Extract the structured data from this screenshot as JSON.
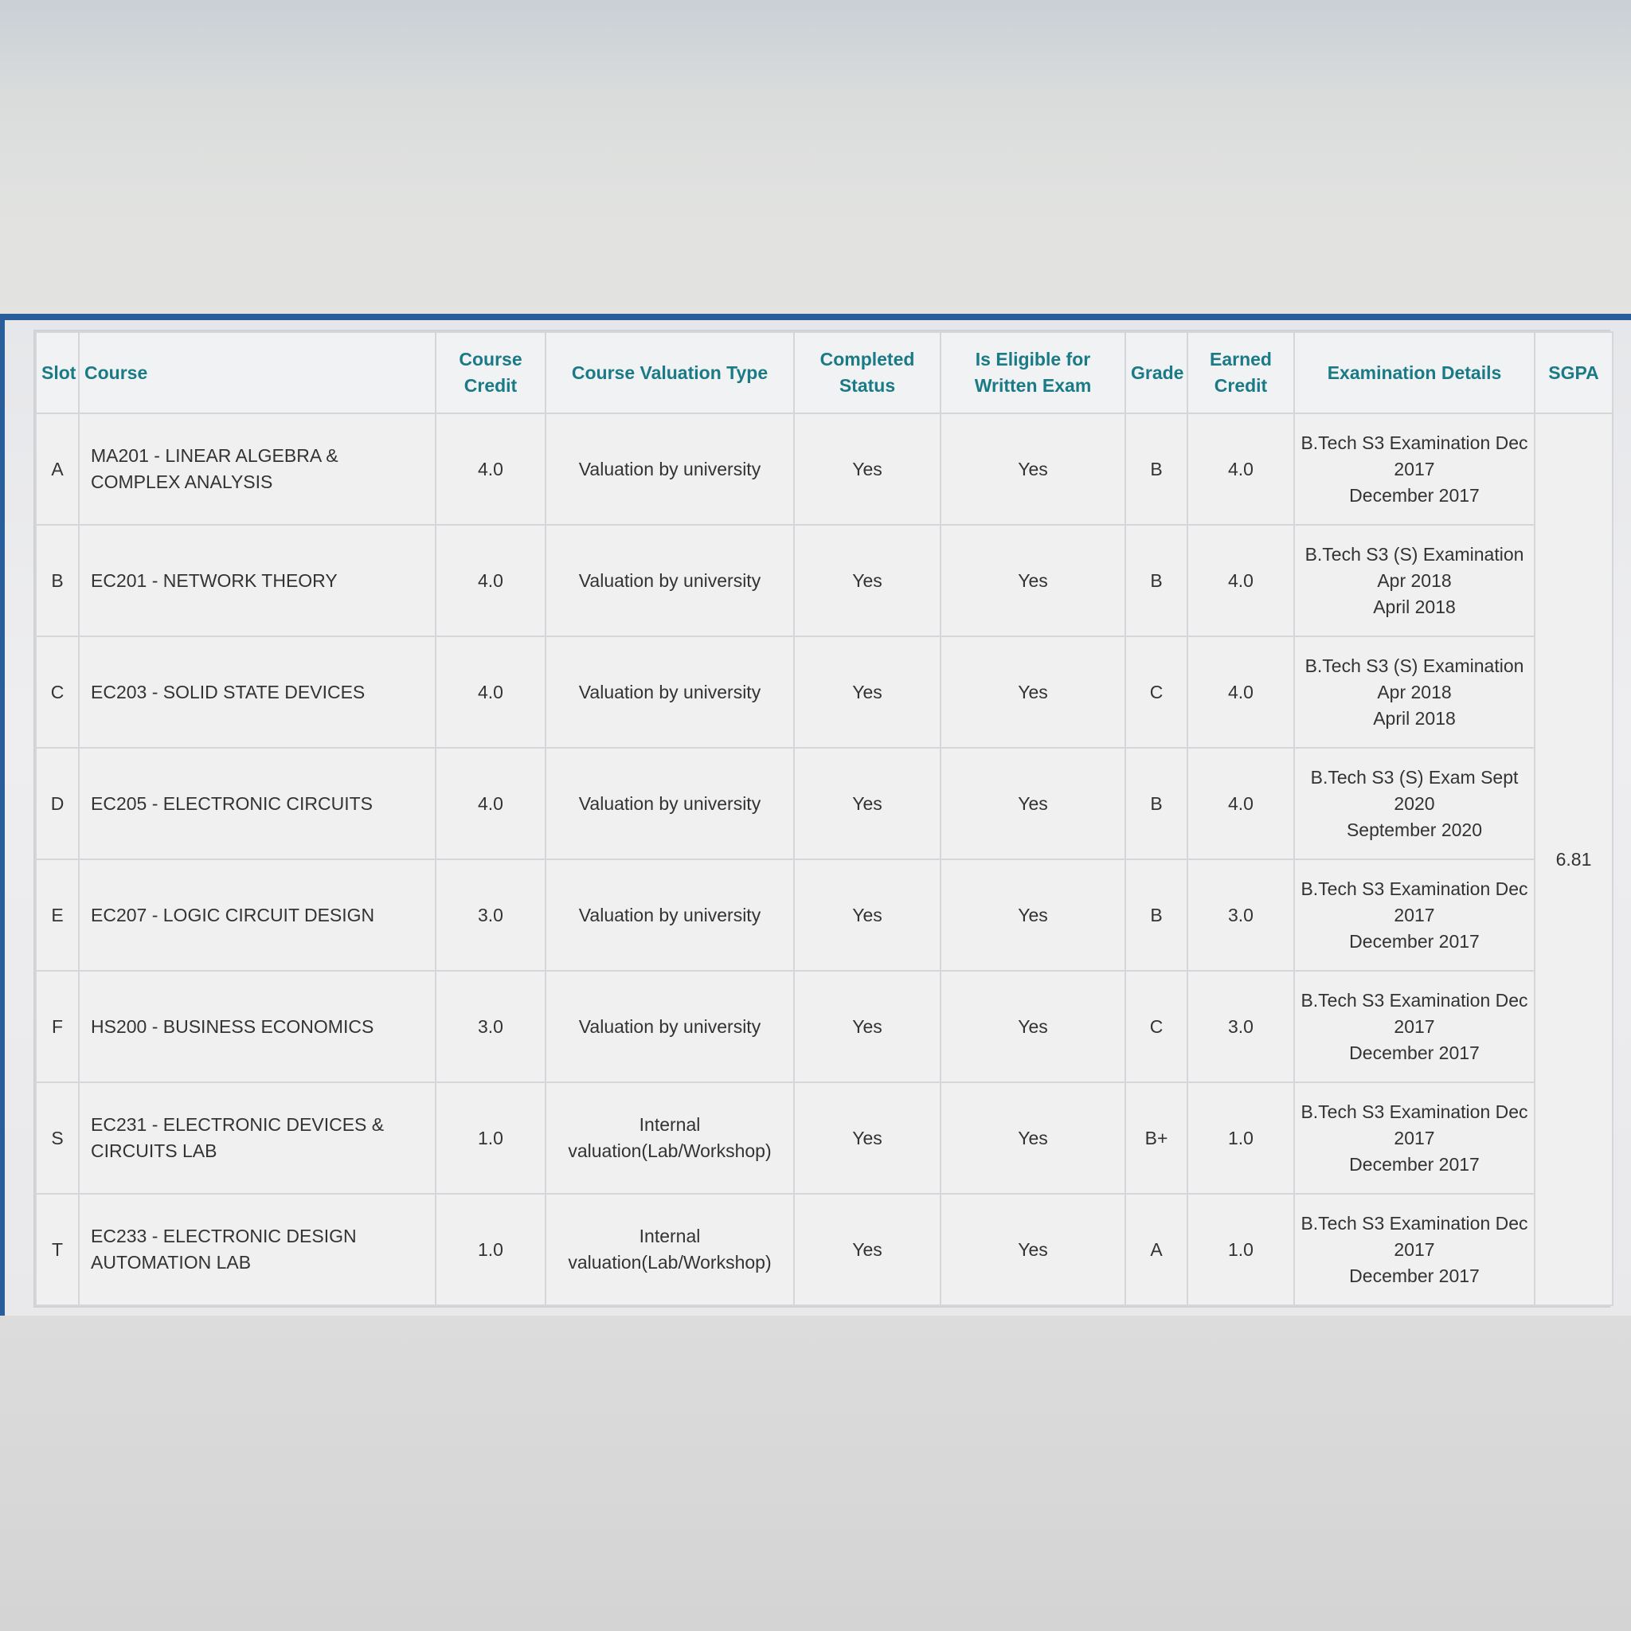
{
  "table": {
    "headers": {
      "slot": "Slot",
      "course": "Course",
      "course_credit": "Course Credit",
      "valuation_type": "Course Valuation Type",
      "completed_status": "Completed Status",
      "eligible": "Is Eligible for Written Exam",
      "grade": "Grade",
      "earned_credit": "Earned Credit",
      "exam_details": "Examination Details",
      "sgpa": "SGPA"
    },
    "rows": [
      {
        "slot": "A",
        "course": "MA201 - LINEAR ALGEBRA & COMPLEX ANALYSIS",
        "credit": "4.0",
        "valuation": "Valuation by university",
        "completed": "Yes",
        "eligible": "Yes",
        "grade": "B",
        "earned": "4.0",
        "exam_line1": "B.Tech S3 Examination Dec 2017",
        "exam_line2": "December 2017"
      },
      {
        "slot": "B",
        "course": "EC201 - NETWORK THEORY",
        "credit": "4.0",
        "valuation": "Valuation by university",
        "completed": "Yes",
        "eligible": "Yes",
        "grade": "B",
        "earned": "4.0",
        "exam_line1": "B.Tech S3 (S) Examination Apr 2018",
        "exam_line2": "April 2018"
      },
      {
        "slot": "C",
        "course": "EC203 - SOLID STATE DEVICES",
        "credit": "4.0",
        "valuation": "Valuation by university",
        "completed": "Yes",
        "eligible": "Yes",
        "grade": "C",
        "earned": "4.0",
        "exam_line1": "B.Tech S3 (S) Examination Apr 2018",
        "exam_line2": "April 2018"
      },
      {
        "slot": "D",
        "course": "EC205 - ELECTRONIC CIRCUITS",
        "credit": "4.0",
        "valuation": "Valuation by university",
        "completed": "Yes",
        "eligible": "Yes",
        "grade": "B",
        "earned": "4.0",
        "exam_line1": "B.Tech S3 (S) Exam Sept 2020",
        "exam_line2": "September 2020"
      },
      {
        "slot": "E",
        "course": "EC207 - LOGIC CIRCUIT DESIGN",
        "credit": "3.0",
        "valuation": "Valuation by university",
        "completed": "Yes",
        "eligible": "Yes",
        "grade": "B",
        "earned": "3.0",
        "exam_line1": "B.Tech S3 Examination Dec 2017",
        "exam_line2": "December 2017"
      },
      {
        "slot": "F",
        "course": "HS200 - BUSINESS ECONOMICS",
        "credit": "3.0",
        "valuation": "Valuation by university",
        "completed": "Yes",
        "eligible": "Yes",
        "grade": "C",
        "earned": "3.0",
        "exam_line1": "B.Tech S3 Examination Dec 2017",
        "exam_line2": "December 2017"
      },
      {
        "slot": "S",
        "course": "EC231 - ELECTRONIC DEVICES & CIRCUITS LAB",
        "credit": "1.0",
        "valuation": "Internal valuation(Lab/Workshop)",
        "completed": "Yes",
        "eligible": "Yes",
        "grade": "B+",
        "earned": "1.0",
        "exam_line1": "B.Tech S3 Examination Dec 2017",
        "exam_line2": "December 2017"
      },
      {
        "slot": "T",
        "course": "EC233 - ELECTRONIC DESIGN AUTOMATION LAB",
        "credit": "1.0",
        "valuation": "Internal valuation(Lab/Workshop)",
        "completed": "Yes",
        "eligible": "Yes",
        "grade": "A",
        "earned": "1.0",
        "exam_line1": "B.Tech S3 Examination Dec 2017",
        "exam_line2": "December 2017"
      }
    ],
    "sgpa": "6.81"
  },
  "colors": {
    "header_text": "#1a7a86",
    "accent_bar": "#2a5e9a"
  }
}
